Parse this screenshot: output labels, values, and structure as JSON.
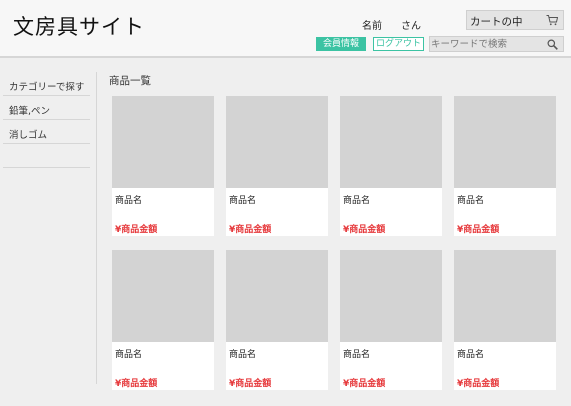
{
  "header": {
    "site_title": "文房具サイト",
    "user_name": "名前",
    "user_suffix": "さん",
    "cart_label": "カートの中",
    "member_info_label": "会員情報",
    "logout_label": "ログアウト",
    "search_placeholder": "キーワードで検索"
  },
  "sidebar": {
    "items": [
      {
        "label": "カテゴリーで探す"
      },
      {
        "label": "鉛筆,ペン"
      },
      {
        "label": "消しゴム"
      }
    ]
  },
  "main": {
    "section_title": "商品一覧",
    "products": [
      {
        "name": "商品名",
        "price": "¥商品金額"
      },
      {
        "name": "商品名",
        "price": "¥商品金額"
      },
      {
        "name": "商品名",
        "price": "¥商品金額"
      },
      {
        "name": "商品名",
        "price": "¥商品金額"
      },
      {
        "name": "商品名",
        "price": "¥商品金額"
      },
      {
        "name": "商品名",
        "price": "¥商品金額"
      },
      {
        "name": "商品名",
        "price": "¥商品金額"
      },
      {
        "name": "商品名",
        "price": "¥商品金額"
      }
    ]
  },
  "icons": {
    "cart": "cart-icon",
    "search": "search-icon"
  },
  "colors": {
    "accent": "#3cc3a3",
    "price": "#e6393c",
    "placeholder_image": "#d3d3d3"
  }
}
